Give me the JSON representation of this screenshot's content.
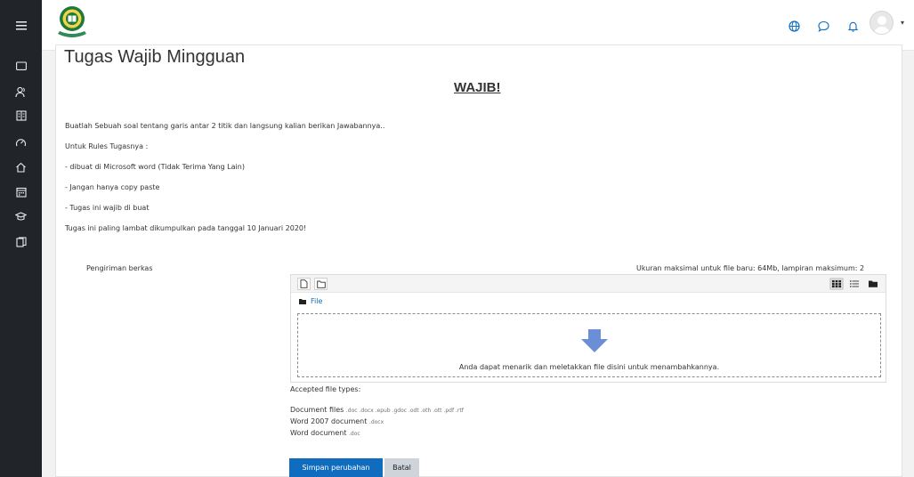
{
  "navbar": {
    "menu_icon": "hamburger-icon",
    "logo": "institution-seal-logo",
    "icons": [
      "language-globe-icon",
      "messages-bubble-icon",
      "notifications-bell-icon"
    ],
    "avatar": "user-avatar",
    "avatar_caret": "▾"
  },
  "drawer": {
    "icons": [
      "folder-icon",
      "participants-icon",
      "grades-icon",
      "dashboard-gauge-icon",
      "home-icon",
      "calendar-icon",
      "courses-cap-icon",
      "content-bank-icon"
    ]
  },
  "page": {
    "title": "Tugas Wajib Mingguan",
    "heading": "WAJIB!"
  },
  "description": [
    "Buatlah Sebuah soal tentang garis antar 2 titik dan langsung kalian berikan Jawabannya..",
    "Untuk Rules Tugasnya :",
    "- dibuat di Microsoft word (Tidak Terima Yang Lain)",
    "- Jangan hanya copy paste",
    "- Tugas ini wajib di buat",
    "Tugas ini paling lambat dikumpulkan pada tanggal 10 Januari 2020!"
  ],
  "submission": {
    "label": "Pengiriman berkas",
    "max_size": "Ukuran maksimal untuk file baru: 64Mb, lampiran maksimum: 2",
    "path_label": "File",
    "drop_text": "Anda dapat menarik dan meletakkan file disini untuk menambahkannya.",
    "accepted_label": "Accepted file types:",
    "types": [
      {
        "name": "Document files",
        "ext": ".doc .docx .epub .gdoc .odt .oth .ott .pdf .rtf"
      },
      {
        "name": "Word 2007 document",
        "ext": ".docx"
      },
      {
        "name": "Word document",
        "ext": ".doc"
      }
    ]
  },
  "buttons": {
    "save": "Simpan perubahan",
    "cancel": "Batal"
  },
  "colors": {
    "primary": "#0f6cbf",
    "drawer_bg": "#212529",
    "cancel_bg": "#ced4da",
    "drop_arrow": "#6b8fd6"
  }
}
